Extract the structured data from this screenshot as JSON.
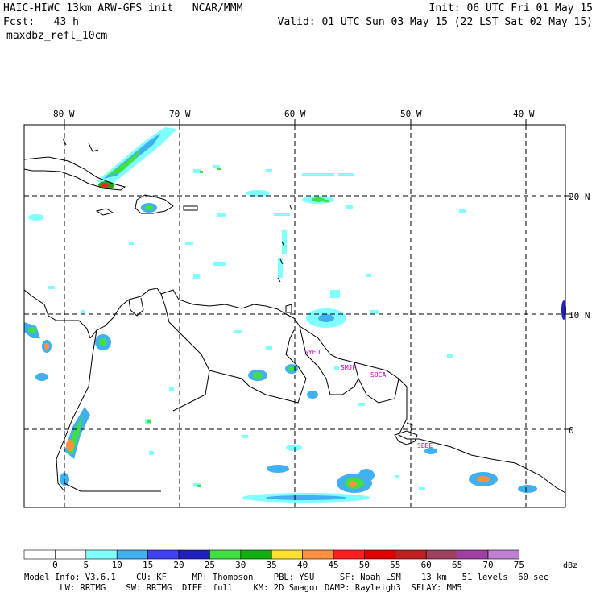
{
  "header": {
    "model_line": "HAIC-HIWC 13km ARW-GFS init   NCAR/MMM",
    "fcst_line": "Fcst:   43 h",
    "field_name": "maxdbz_refl_10cm",
    "init_line": "Init: 06 UTC Fri 01 May 15",
    "valid_line": "Valid: 01 UTC Sun 03 May 15 (22 LST Sat 02 May 15)"
  },
  "map": {
    "lon_labels": [
      "80 W",
      "70 W",
      "60 W",
      "50 W",
      "40 W"
    ],
    "lat_labels": [
      "20 N",
      "10 N",
      "0"
    ],
    "stations": [
      "SYEU",
      "SMJP",
      "SOCA",
      "SBBE"
    ],
    "station_color": "#c000c0"
  },
  "colorbar": {
    "unit": "dBz",
    "ticks": [
      "0",
      "5",
      "10",
      "15",
      "20",
      "25",
      "30",
      "35",
      "40",
      "45",
      "50",
      "55",
      "60",
      "65",
      "70",
      "75"
    ],
    "colors": [
      "#ffffff",
      "#ffffff",
      "#80ffff",
      "#40b0f0",
      "#4040f0",
      "#2020c0",
      "#40e040",
      "#10b010",
      "#ffe030",
      "#ff9040",
      "#ff2020",
      "#e00000",
      "#c02020",
      "#a04060",
      "#a040a0",
      "#c080d0"
    ]
  },
  "footer": {
    "line1": "Model Info: V3.6.1    CU: KF     MP: Thompson    PBL: YSU     SF: Noah LSM    13 km   51 levels  60 sec",
    "line2": "       LW: RRTMG    SW: RRTMG  DIFF: full    KM: 2D Smagor DAMP: Rayleigh3  SFLAY: MM5"
  }
}
